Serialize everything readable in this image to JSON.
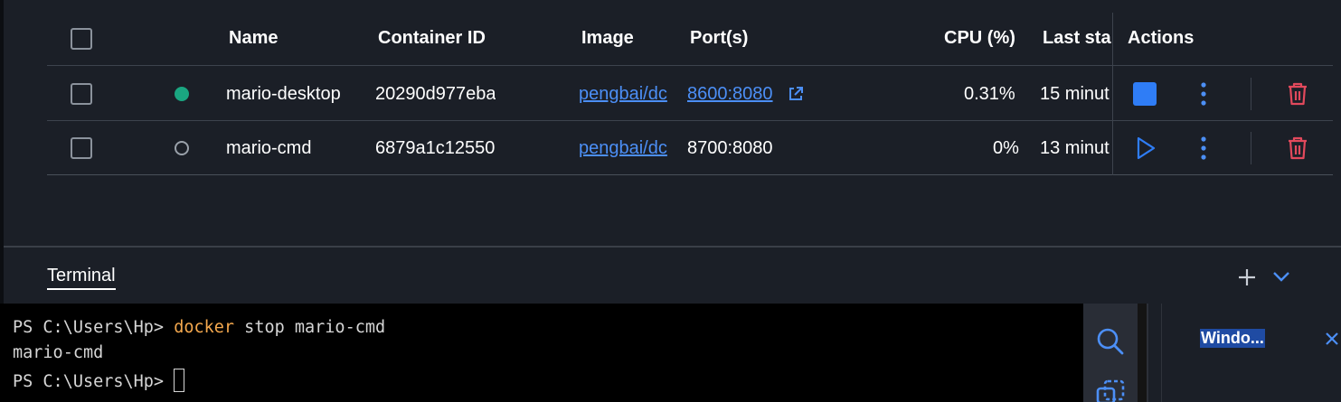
{
  "table": {
    "headers": {
      "name": "Name",
      "container_id": "Container ID",
      "image": "Image",
      "ports": "Port(s)",
      "cpu": "CPU (%)",
      "last_started": "Last sta",
      "actions": "Actions"
    },
    "rows": [
      {
        "status": "running",
        "name": "mario-desktop",
        "container_id": "20290d977eba",
        "image": "pengbai/dc",
        "ports": "8600:8080",
        "cpu": "0.31%",
        "last_started": "15 minut",
        "primary_action": "stop"
      },
      {
        "status": "stopped",
        "name": "mario-cmd",
        "container_id": "6879a1c12550",
        "image": "pengbai/dc",
        "ports": "8700:8080",
        "cpu": "0%",
        "last_started": "13 minut",
        "primary_action": "start"
      }
    ]
  },
  "terminal": {
    "tab_label": "Terminal",
    "prompt": "PS C:\\Users\\Hp> ",
    "command_keyword": "docker",
    "command_rest": " stop mario-cmd",
    "output": "mario-cmd",
    "prompt2": "PS C:\\Users\\Hp> "
  },
  "side_panel": {
    "window_label": "Windo..."
  },
  "colors": {
    "background": "#1b1f27",
    "accent": "#2f7df6",
    "running": "#1aa681",
    "danger": "#e2495c",
    "link": "#4c8ff6"
  }
}
